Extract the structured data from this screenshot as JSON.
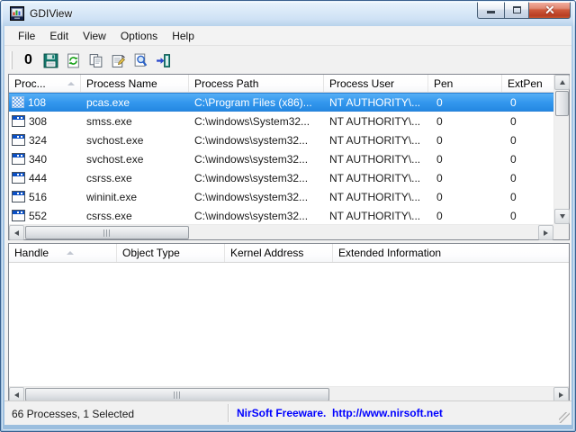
{
  "window": {
    "title": "GDIView"
  },
  "menu": {
    "items": [
      "File",
      "Edit",
      "View",
      "Options",
      "Help"
    ]
  },
  "toolbar": {
    "zero_glyph": "0",
    "buttons": [
      {
        "name": "reset-gdi-counters-button",
        "icon": "zero-icon"
      },
      {
        "name": "save-button",
        "icon": "save-icon"
      },
      {
        "name": "refresh-button",
        "icon": "refresh-icon"
      },
      {
        "name": "copy-button",
        "icon": "copy-icon"
      },
      {
        "name": "properties-button",
        "icon": "properties-icon"
      },
      {
        "name": "find-button",
        "icon": "find-icon"
      },
      {
        "name": "exit-button",
        "icon": "exit-icon"
      }
    ]
  },
  "process_table": {
    "columns": [
      "Proc...",
      "Process Name",
      "Process Path",
      "Process User",
      "Pen",
      "ExtPen"
    ],
    "sort_column_index": 0,
    "sort_direction": "ascending",
    "rows": [
      {
        "icon": "grid-icon",
        "id": "108",
        "name": "pcas.exe",
        "path": "C:\\Program Files (x86)...",
        "user": "NT AUTHORITY\\...",
        "pen": "0",
        "extpen": "0",
        "selected": true
      },
      {
        "icon": "window-icon",
        "id": "308",
        "name": "smss.exe",
        "path": "C:\\windows\\System32...",
        "user": "NT AUTHORITY\\...",
        "pen": "0",
        "extpen": "0",
        "selected": false
      },
      {
        "icon": "window-icon",
        "id": "324",
        "name": "svchost.exe",
        "path": "C:\\windows\\system32...",
        "user": "NT AUTHORITY\\...",
        "pen": "0",
        "extpen": "0",
        "selected": false
      },
      {
        "icon": "window-icon",
        "id": "340",
        "name": "svchost.exe",
        "path": "C:\\windows\\system32...",
        "user": "NT AUTHORITY\\...",
        "pen": "0",
        "extpen": "0",
        "selected": false
      },
      {
        "icon": "window-icon",
        "id": "444",
        "name": "csrss.exe",
        "path": "C:\\windows\\system32...",
        "user": "NT AUTHORITY\\...",
        "pen": "0",
        "extpen": "0",
        "selected": false
      },
      {
        "icon": "window-icon",
        "id": "516",
        "name": "wininit.exe",
        "path": "C:\\windows\\system32...",
        "user": "NT AUTHORITY\\...",
        "pen": "0",
        "extpen": "0",
        "selected": false
      },
      {
        "icon": "window-icon",
        "id": "552",
        "name": "csrss.exe",
        "path": "C:\\windows\\system32...",
        "user": "NT AUTHORITY\\...",
        "pen": "0",
        "extpen": "0",
        "selected": false
      }
    ]
  },
  "handle_table": {
    "columns": [
      "Handle",
      "Object Type",
      "Kernel Address",
      "Extended Information"
    ],
    "sort_column_index": 0,
    "sort_direction": "ascending",
    "rows": []
  },
  "status_bar": {
    "left": "66 Processes, 1 Selected",
    "right": "NirSoft Freeware.  http://www.nirsoft.net"
  },
  "colors": {
    "selection_blue": "#3498ee",
    "link_blue": "#0000ff",
    "titlebar_glass": "#b4d0ea",
    "close_button_red": "#cf5b3d"
  }
}
